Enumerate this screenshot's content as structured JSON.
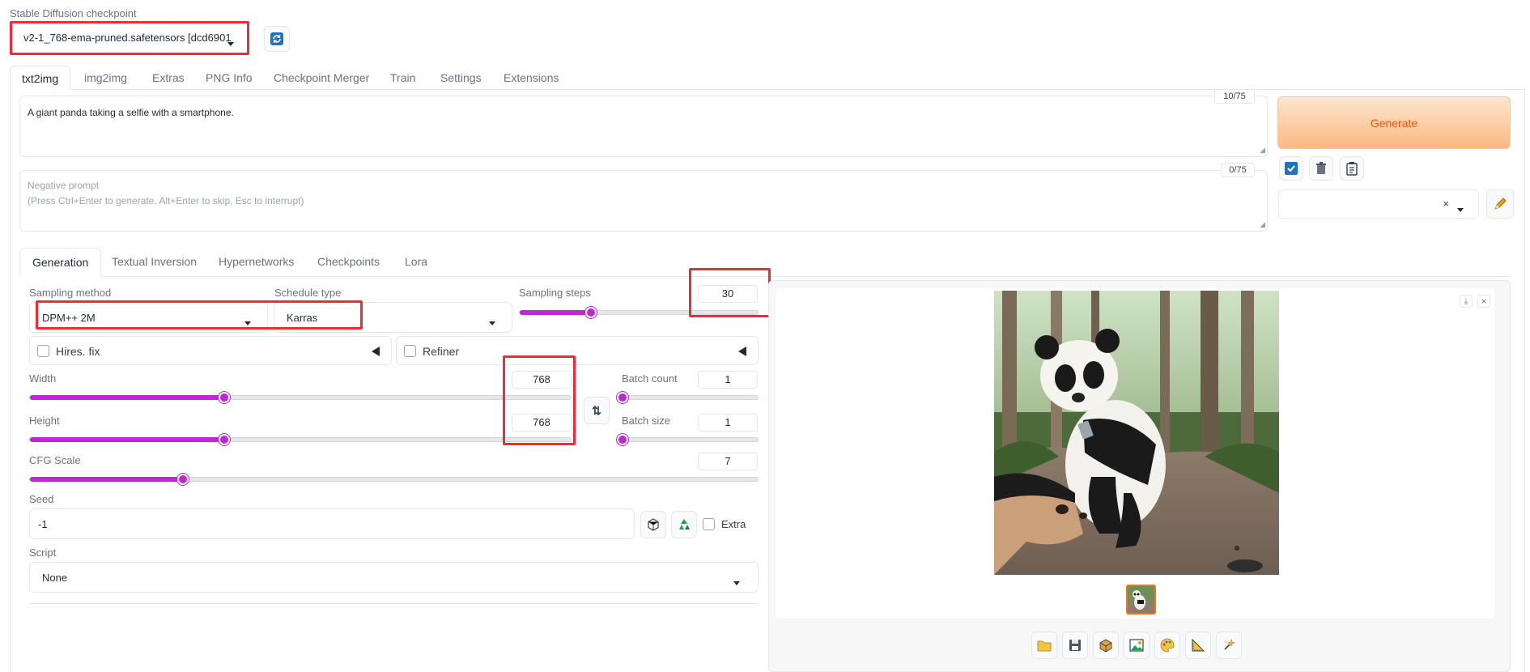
{
  "checkpoint": {
    "label": "Stable Diffusion checkpoint",
    "value": "v2-1_768-ema-pruned.safetensors [dcd6901"
  },
  "main_tabs": [
    "txt2img",
    "img2img",
    "Extras",
    "PNG Info",
    "Checkpoint Merger",
    "Train",
    "Settings",
    "Extensions"
  ],
  "prompt": {
    "text": "A giant panda taking a selfie with a smartphone.",
    "counter": "10/75"
  },
  "negative_prompt": {
    "placeholder_line1": "Negative prompt",
    "placeholder_line2": "(Press Ctrl+Enter to generate, Alt+Enter to skip, Esc to interrupt)",
    "counter": "0/75"
  },
  "generate_label": "Generate",
  "sub_tabs": [
    "Generation",
    "Textual Inversion",
    "Hypernetworks",
    "Checkpoints",
    "Lora"
  ],
  "sampling": {
    "method_label": "Sampling method",
    "method_value": "DPM++ 2M",
    "schedule_label": "Schedule type",
    "schedule_value": "Karras",
    "steps_label": "Sampling steps",
    "steps_value": "30",
    "steps_fraction": 0.3
  },
  "hires": {
    "label": "Hires. fix"
  },
  "refiner": {
    "label": "Refiner"
  },
  "width": {
    "label": "Width",
    "value": "768",
    "fraction": 0.36
  },
  "height": {
    "label": "Height",
    "value": "768",
    "fraction": 0.36
  },
  "batch_count": {
    "label": "Batch count",
    "value": "1",
    "fraction": 0.0
  },
  "batch_size": {
    "label": "Batch size",
    "value": "1",
    "fraction": 0.0
  },
  "cfg": {
    "label": "CFG Scale",
    "value": "7",
    "fraction": 0.21
  },
  "seed": {
    "label": "Seed",
    "value": "-1",
    "extra_label": "Extra"
  },
  "script": {
    "label": "Script",
    "value": "None"
  },
  "colors": {
    "accent": "#c026d3",
    "generate_text": "#ea580c",
    "highlight": "#ef2b38"
  },
  "icons": [
    "refresh-icon",
    "checkbox-icon",
    "trash-icon",
    "clipboard-icon",
    "clear-icon",
    "pencil-icon",
    "dice-icon",
    "recycle-icon",
    "swap-icon",
    "folder-icon",
    "save-icon",
    "zip-icon",
    "image-icon",
    "palette-icon",
    "ruler-icon",
    "sparkle-icon",
    "download-icon",
    "close-icon"
  ]
}
